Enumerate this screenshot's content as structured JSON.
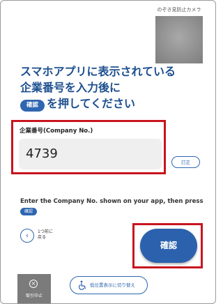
{
  "camera": {
    "label": "のぞき見防止カメラ"
  },
  "instruction": {
    "line1": "スマホアプリに表示されている",
    "line2": "企業番号を入力後に",
    "confirm_pill": "確認",
    "line3": "を押してください"
  },
  "company_field": {
    "label": "企業番号(Company No.)",
    "value": "4739"
  },
  "correct_button": "訂正",
  "english_instruction": {
    "text": "Enter the Company No. shown on your app, then press",
    "pill": "確認"
  },
  "back": {
    "label_line1": "1つ前に",
    "label_line2": "戻る"
  },
  "confirm_button": "確認",
  "cancel_button": {
    "label": "取引中止"
  },
  "low_position_button": {
    "label": "低位置表示に切り替え"
  },
  "colors": {
    "accent": "#2f66b0",
    "heading": "#1d4f8f",
    "highlight_frame": "#c8141f",
    "cancel_bg": "#7b7b7b"
  }
}
